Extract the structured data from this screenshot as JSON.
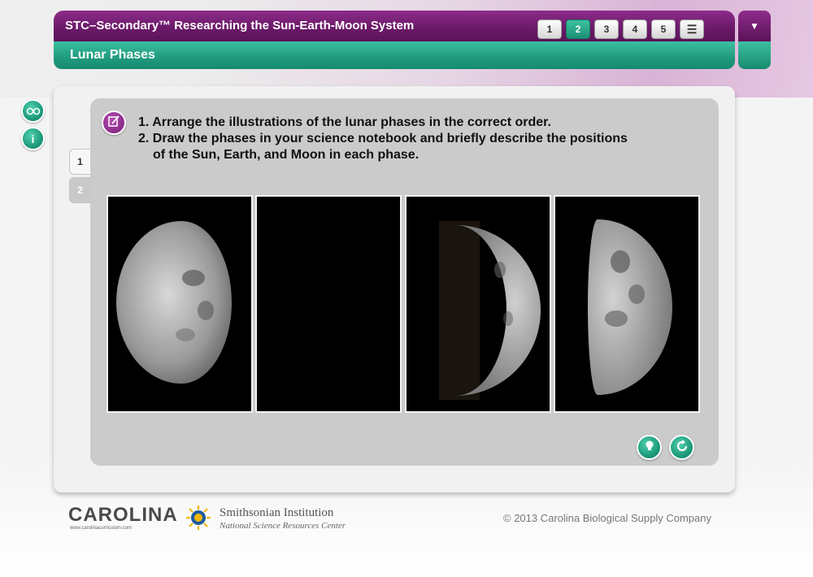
{
  "header": {
    "app_title": "STC–Secondary™ Researching the Sun-Earth-Moon System",
    "section_title": "Lunar Phases",
    "pages": [
      "1",
      "2",
      "3",
      "4",
      "5"
    ],
    "active_page": "2",
    "menu_icon": "menu-icon",
    "dropdown_icon": "caret-down-icon"
  },
  "sidebar": {
    "buttons": [
      {
        "name": "goggles-icon",
        "glyph": "⚇"
      },
      {
        "name": "info-icon",
        "glyph": "i"
      }
    ]
  },
  "steps": [
    "1",
    "2"
  ],
  "instructions": {
    "line1": "1. Arrange the illustrations of the lunar phases in the correct order.",
    "line2": "2. Draw the phases in your science notebook and briefly describe the positions",
    "line2b": "of the Sun, Earth, and Moon in each phase."
  },
  "moon_cards": [
    {
      "phase": "waning-gibbous",
      "illumination": 0.88
    },
    {
      "phase": "new-moon",
      "illumination": 0.0
    },
    {
      "phase": "waxing-crescent",
      "illumination": 0.25
    },
    {
      "phase": "first-quarter",
      "illumination": 0.5
    }
  ],
  "actions": {
    "hint_icon": "hint-icon",
    "reset_icon": "reset-icon"
  },
  "footer": {
    "carolina_logo": "CAROLINA",
    "carolina_url": "www.carolinacurriculum.com",
    "smithsonian_name": "Smithsonian Institution",
    "smithsonian_sub": "National Science Resources Center",
    "copyright": "© 2013 Carolina Biological Supply Company"
  },
  "colors": {
    "purple": "#7a1f78",
    "teal": "#1e9b7c",
    "panel_gray": "#cbcbcb"
  }
}
